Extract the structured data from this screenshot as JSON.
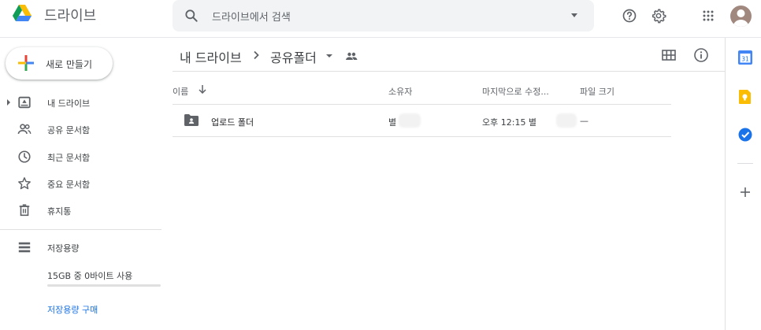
{
  "header": {
    "app_name": "드라이브",
    "search_placeholder": "드라이브에서 검색",
    "icons": [
      "drive-logo",
      "search-icon",
      "search-options-caret",
      "help-icon",
      "settings-gear-icon",
      "apps-grid-icon",
      "account-avatar"
    ]
  },
  "sidebar": {
    "new_button": "새로 만들기",
    "items": [
      {
        "label": "내 드라이브",
        "icon": "my-drive-icon"
      },
      {
        "label": "공유 문서함",
        "icon": "shared-people-icon"
      },
      {
        "label": "최근 문서함",
        "icon": "clock-icon"
      },
      {
        "label": "중요 문서함",
        "icon": "star-icon"
      },
      {
        "label": "휴지통",
        "icon": "trash-icon"
      }
    ],
    "storage": {
      "label": "저장용량",
      "usage": "15GB 중 0바이트 사용",
      "used_fraction": 0,
      "buy_link": "저장용량 구매"
    }
  },
  "main": {
    "breadcrumb": {
      "root": "내 드라이브",
      "current": "공유폴더"
    },
    "columns": {
      "name": "이름",
      "owner": "소유자",
      "modified": "마지막으로 수정...",
      "size": "파일 크기"
    },
    "rows": [
      {
        "name": "업로드 폴더",
        "owner": "별",
        "modified": "오후 12:15 별",
        "size": "—"
      }
    ]
  },
  "side_panel": {
    "apps": [
      "calendar-icon",
      "keep-icon",
      "tasks-icon"
    ],
    "add_label": "+"
  },
  "colors": {
    "accent": "#1a73e8",
    "text": "#3c4043",
    "muted": "#5f6368",
    "search_bg": "#f1f3f4",
    "divider": "#e0e0e0"
  }
}
